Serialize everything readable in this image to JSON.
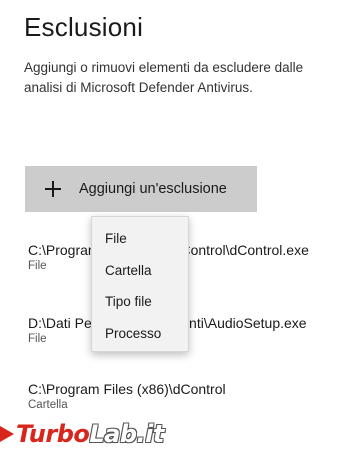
{
  "page": {
    "title": "Esclusioni",
    "description": "Aggiungi o rimuovi elementi da escludere dalle analisi di Microsoft Defender Antivirus."
  },
  "add_button": {
    "icon": "plus-icon",
    "label": "Aggiungi un'esclusione"
  },
  "exclusions": [
    {
      "path": "C:\\Program Files (x86)\\dControl\\dControl.exe",
      "type": "File"
    },
    {
      "path": "D:\\Dati Personali\\Documenti\\AudioSetup.exe",
      "type": "File"
    },
    {
      "path": "C:\\Program Files (x86)\\dControl",
      "type": "Cartella"
    }
  ],
  "menu": {
    "items": [
      "File",
      "Cartella",
      "Tipo file",
      "Processo"
    ]
  },
  "watermark": {
    "part1": "Turbo",
    "part2": "Lab",
    "part3": ".it"
  },
  "colors": {
    "button_bg": "#cccccc",
    "menu_bg": "#f2f2f2",
    "watermark_red": "#d9261c"
  }
}
